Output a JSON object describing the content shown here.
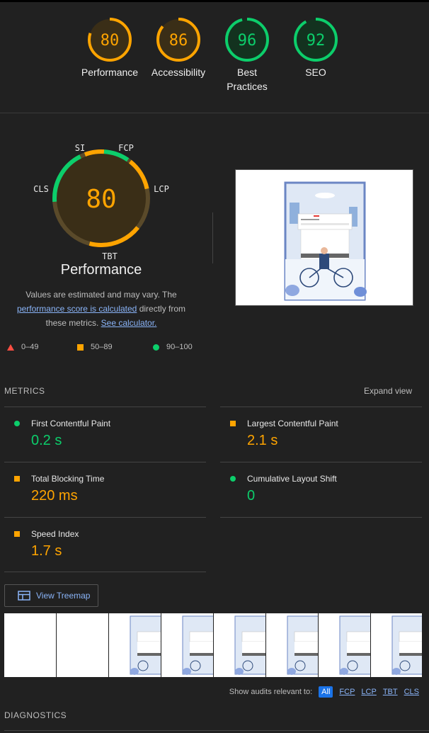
{
  "colors": {
    "orange": "#ffa400",
    "green": "#0cce6b",
    "red": "#ff4e42",
    "link": "#8ab4f8"
  },
  "categories": [
    {
      "score": "80",
      "label": "Performance",
      "rating": "orange",
      "fraction": 0.8
    },
    {
      "score": "86",
      "label": "Accessibility",
      "rating": "orange",
      "fraction": 0.86
    },
    {
      "score": "96",
      "label": "Best Practices",
      "rating": "green",
      "fraction": 0.96
    },
    {
      "score": "92",
      "label": "SEO",
      "rating": "green",
      "fraction": 0.92
    }
  ],
  "performance": {
    "score": "80",
    "title": "Performance",
    "segments": {
      "si": "SI",
      "fcp": "FCP",
      "lcp": "LCP",
      "tbt": "TBT",
      "cls": "CLS"
    },
    "note_prefix": "Values are estimated and may vary. The",
    "note_link": "performance score is calculated",
    "note_mid": "directly from these metrics.",
    "note_link2": "See calculator."
  },
  "legend": {
    "fail": "0–49",
    "average": "50–89",
    "pass": "90–100"
  },
  "metrics": {
    "header": "METRICS",
    "expand": "Expand view",
    "items": [
      {
        "title": "First Contentful Paint",
        "value": "0.2 s",
        "rating": "pass"
      },
      {
        "title": "Largest Contentful Paint",
        "value": "2.1 s",
        "rating": "average"
      },
      {
        "title": "Total Blocking Time",
        "value": "220 ms",
        "rating": "average"
      },
      {
        "title": "Cumulative Layout Shift",
        "value": "0",
        "rating": "pass"
      },
      {
        "title": "Speed Index",
        "value": "1.7 s",
        "rating": "average"
      }
    ]
  },
  "treemap": {
    "label": "View Treemap",
    "icon": "treemap-icon"
  },
  "filters": {
    "label": "Show audits relevant to:",
    "items": [
      "All",
      "FCP",
      "LCP",
      "TBT",
      "CLS"
    ]
  },
  "diagnostics": {
    "header": "DIAGNOSTICS"
  }
}
